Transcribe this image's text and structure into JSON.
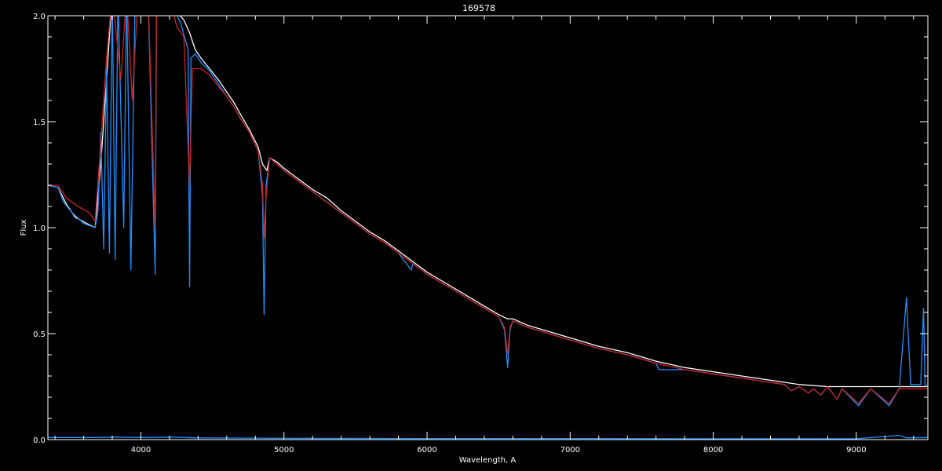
{
  "chart_data": {
    "type": "line",
    "title": "169578",
    "xlabel": "Wavelength, A",
    "ylabel": "Flux",
    "xlim": [
      3350,
      9500
    ],
    "ylim": [
      0,
      2
    ],
    "xticks": [
      4000,
      5000,
      6000,
      7000,
      8000,
      9000
    ],
    "xtick_labels": [
      "4000",
      "5000",
      "6000",
      "7000",
      "8000",
      "9000"
    ],
    "yticks": [
      0,
      0.5,
      1,
      1.5,
      2
    ],
    "ytick_labels": [
      "0.0",
      "0.5",
      "1.0",
      "1.5",
      "2.0"
    ],
    "grid": false,
    "legend": "none",
    "background": "#000000",
    "axis_color": "#ffffff",
    "series": [
      {
        "color": "#ffffff",
        "points": [
          [
            3350,
            1.2
          ],
          [
            3420,
            1.19
          ],
          [
            3480,
            1.11
          ],
          [
            3540,
            1.05
          ],
          [
            3620,
            1.02
          ],
          [
            3680,
            1.0
          ],
          [
            3720,
            1.3
          ],
          [
            3760,
            1.7
          ],
          [
            3800,
            2.1
          ],
          [
            3900,
            2.1
          ],
          [
            4000,
            2.1
          ],
          [
            4100,
            2.1
          ],
          [
            4200,
            2.1
          ],
          [
            4250,
            2.02
          ],
          [
            4300,
            1.98
          ],
          [
            4340,
            1.92
          ],
          [
            4380,
            1.84
          ],
          [
            4420,
            1.8
          ],
          [
            4480,
            1.75
          ],
          [
            4550,
            1.69
          ],
          [
            4600,
            1.64
          ],
          [
            4650,
            1.59
          ],
          [
            4700,
            1.53
          ],
          [
            4760,
            1.46
          ],
          [
            4820,
            1.38
          ],
          [
            4850,
            1.3
          ],
          [
            4880,
            1.27
          ],
          [
            4900,
            1.33
          ],
          [
            4950,
            1.31
          ],
          [
            5000,
            1.28
          ],
          [
            5100,
            1.23
          ],
          [
            5200,
            1.18
          ],
          [
            5300,
            1.14
          ],
          [
            5400,
            1.08
          ],
          [
            5500,
            1.03
          ],
          [
            5600,
            0.98
          ],
          [
            5700,
            0.94
          ],
          [
            5800,
            0.89
          ],
          [
            5900,
            0.84
          ],
          [
            6000,
            0.79
          ],
          [
            6100,
            0.75
          ],
          [
            6200,
            0.71
          ],
          [
            6300,
            0.67
          ],
          [
            6400,
            0.63
          ],
          [
            6500,
            0.59
          ],
          [
            6560,
            0.57
          ],
          [
            6600,
            0.57
          ],
          [
            6700,
            0.54
          ],
          [
            6800,
            0.52
          ],
          [
            6900,
            0.5
          ],
          [
            7000,
            0.48
          ],
          [
            7200,
            0.44
          ],
          [
            7400,
            0.41
          ],
          [
            7600,
            0.37
          ],
          [
            7800,
            0.34
          ],
          [
            8000,
            0.32
          ],
          [
            8200,
            0.3
          ],
          [
            8400,
            0.28
          ],
          [
            8600,
            0.26
          ],
          [
            8800,
            0.25
          ],
          [
            9000,
            0.25
          ],
          [
            9200,
            0.25
          ],
          [
            9300,
            0.25
          ],
          [
            9500,
            0.25
          ]
        ]
      },
      {
        "color": "#1e90ff",
        "points": [
          [
            3350,
            1.2
          ],
          [
            3420,
            1.19
          ],
          [
            3460,
            1.12
          ],
          [
            3520,
            1.07
          ],
          [
            3600,
            1.02
          ],
          [
            3680,
            1.0
          ],
          [
            3700,
            1.08
          ],
          [
            3720,
            1.45
          ],
          [
            3740,
            0.9
          ],
          [
            3760,
            1.75
          ],
          [
            3780,
            0.88
          ],
          [
            3800,
            2.1
          ],
          [
            3820,
            0.85
          ],
          [
            3840,
            2.1
          ],
          [
            3880,
            1.0
          ],
          [
            3900,
            2.1
          ],
          [
            3930,
            0.8
          ],
          [
            3960,
            2.1
          ],
          [
            4000,
            2.1
          ],
          [
            4050,
            2.1
          ],
          [
            4100,
            0.78
          ],
          [
            4110,
            2.1
          ],
          [
            4200,
            2.1
          ],
          [
            4240,
            2.02
          ],
          [
            4280,
            1.96
          ],
          [
            4330,
            1.84
          ],
          [
            4340,
            0.72
          ],
          [
            4350,
            1.8
          ],
          [
            4380,
            1.82
          ],
          [
            4420,
            1.78
          ],
          [
            4480,
            1.74
          ],
          [
            4550,
            1.67
          ],
          [
            4600,
            1.62
          ],
          [
            4650,
            1.57
          ],
          [
            4700,
            1.51
          ],
          [
            4760,
            1.45
          ],
          [
            4820,
            1.36
          ],
          [
            4850,
            1.15
          ],
          [
            4861,
            0.59
          ],
          [
            4875,
            1.2
          ],
          [
            4900,
            1.33
          ],
          [
            4950,
            1.3
          ],
          [
            5000,
            1.27
          ],
          [
            5100,
            1.22
          ],
          [
            5200,
            1.17
          ],
          [
            5300,
            1.12
          ],
          [
            5400,
            1.07
          ],
          [
            5500,
            1.02
          ],
          [
            5600,
            0.97
          ],
          [
            5700,
            0.93
          ],
          [
            5800,
            0.88
          ],
          [
            5890,
            0.8
          ],
          [
            5900,
            0.83
          ],
          [
            6000,
            0.78
          ],
          [
            6100,
            0.74
          ],
          [
            6200,
            0.7
          ],
          [
            6300,
            0.66
          ],
          [
            6400,
            0.62
          ],
          [
            6500,
            0.58
          ],
          [
            6540,
            0.52
          ],
          [
            6563,
            0.34
          ],
          [
            6580,
            0.52
          ],
          [
            6600,
            0.56
          ],
          [
            6700,
            0.53
          ],
          [
            6800,
            0.51
          ],
          [
            6900,
            0.49
          ],
          [
            7000,
            0.47
          ],
          [
            7200,
            0.43
          ],
          [
            7400,
            0.4
          ],
          [
            7600,
            0.36
          ],
          [
            7620,
            0.33
          ],
          [
            7800,
            0.33
          ],
          [
            8000,
            0.31
          ],
          [
            8200,
            0.29
          ],
          [
            8400,
            0.27
          ],
          [
            8500,
            0.26
          ],
          [
            8545,
            0.23
          ],
          [
            8600,
            0.25
          ],
          [
            8665,
            0.22
          ],
          [
            8700,
            0.24
          ],
          [
            8750,
            0.21
          ],
          [
            8800,
            0.25
          ],
          [
            8865,
            0.19
          ],
          [
            8900,
            0.24
          ],
          [
            9015,
            0.16
          ],
          [
            9100,
            0.24
          ],
          [
            9229,
            0.16
          ],
          [
            9300,
            0.24
          ],
          [
            9350,
            0.67
          ],
          [
            9380,
            0.26
          ],
          [
            9450,
            0.26
          ],
          [
            9470,
            0.62
          ],
          [
            9480,
            0.26
          ],
          [
            9500,
            0.25
          ]
        ]
      },
      {
        "color": "#cc2222",
        "points": [
          [
            3350,
            1.2
          ],
          [
            3420,
            1.2
          ],
          [
            3480,
            1.14
          ],
          [
            3560,
            1.1
          ],
          [
            3640,
            1.07
          ],
          [
            3680,
            1.03
          ],
          [
            3720,
            1.4
          ],
          [
            3760,
            1.8
          ],
          [
            3800,
            2.1
          ],
          [
            3860,
            1.7
          ],
          [
            3900,
            2.1
          ],
          [
            3940,
            1.6
          ],
          [
            3980,
            2.1
          ],
          [
            4050,
            2.1
          ],
          [
            4100,
            1.0
          ],
          [
            4110,
            2.1
          ],
          [
            4200,
            2.1
          ],
          [
            4250,
            1.95
          ],
          [
            4300,
            1.9
          ],
          [
            4340,
            1.2
          ],
          [
            4360,
            1.75
          ],
          [
            4420,
            1.75
          ],
          [
            4480,
            1.72
          ],
          [
            4550,
            1.66
          ],
          [
            4600,
            1.62
          ],
          [
            4650,
            1.57
          ],
          [
            4700,
            1.51
          ],
          [
            4760,
            1.45
          ],
          [
            4820,
            1.36
          ],
          [
            4850,
            1.2
          ],
          [
            4861,
            0.95
          ],
          [
            4875,
            1.15
          ],
          [
            4900,
            1.33
          ],
          [
            4950,
            1.3
          ],
          [
            5000,
            1.27
          ],
          [
            5100,
            1.22
          ],
          [
            5200,
            1.17
          ],
          [
            5300,
            1.12
          ],
          [
            5400,
            1.07
          ],
          [
            5500,
            1.02
          ],
          [
            5600,
            0.97
          ],
          [
            5700,
            0.93
          ],
          [
            5800,
            0.88
          ],
          [
            5900,
            0.83
          ],
          [
            6000,
            0.78
          ],
          [
            6100,
            0.74
          ],
          [
            6200,
            0.7
          ],
          [
            6300,
            0.66
          ],
          [
            6400,
            0.62
          ],
          [
            6500,
            0.58
          ],
          [
            6540,
            0.53
          ],
          [
            6563,
            0.4
          ],
          [
            6580,
            0.53
          ],
          [
            6600,
            0.56
          ],
          [
            6700,
            0.53
          ],
          [
            6800,
            0.51
          ],
          [
            6900,
            0.49
          ],
          [
            7000,
            0.47
          ],
          [
            7200,
            0.43
          ],
          [
            7400,
            0.4
          ],
          [
            7600,
            0.36
          ],
          [
            7800,
            0.33
          ],
          [
            8000,
            0.31
          ],
          [
            8200,
            0.29
          ],
          [
            8400,
            0.27
          ],
          [
            8500,
            0.26
          ],
          [
            8545,
            0.23
          ],
          [
            8600,
            0.25
          ],
          [
            8665,
            0.22
          ],
          [
            8700,
            0.24
          ],
          [
            8750,
            0.21
          ],
          [
            8800,
            0.25
          ],
          [
            8865,
            0.19
          ],
          [
            8900,
            0.24
          ],
          [
            9015,
            0.17
          ],
          [
            9100,
            0.24
          ],
          [
            9229,
            0.17
          ],
          [
            9300,
            0.24
          ],
          [
            9500,
            0.24
          ]
        ]
      },
      {
        "color": "#1e90ff",
        "points": [
          [
            3350,
            0.01
          ],
          [
            3700,
            0.01
          ],
          [
            3800,
            0.012
          ],
          [
            4000,
            0.01
          ],
          [
            4200,
            0.012
          ],
          [
            4400,
            0.008
          ],
          [
            5000,
            0.006
          ],
          [
            6000,
            0.005
          ],
          [
            7000,
            0.005
          ],
          [
            8000,
            0.004
          ],
          [
            9000,
            0.004
          ],
          [
            9300,
            0.02
          ],
          [
            9350,
            0.008
          ],
          [
            9500,
            0.01
          ]
        ]
      }
    ]
  }
}
